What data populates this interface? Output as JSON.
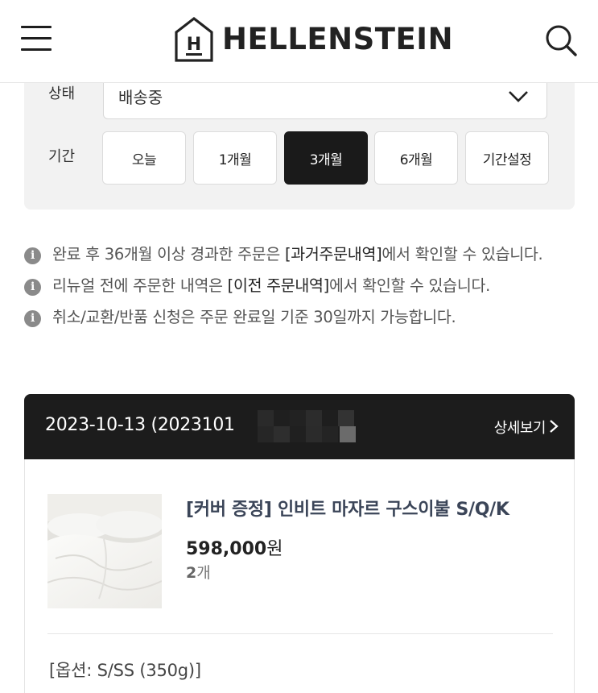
{
  "brand": {
    "name": "HELLENSTEIN",
    "mark_letter": "H"
  },
  "icons": {
    "menu": "hamburger-icon",
    "search": "search-icon",
    "dropdown": "chevron-down-icon",
    "info": "info-icon",
    "detail": "chevron-right-icon"
  },
  "filter": {
    "status_label": "상태",
    "status_value": "배송중",
    "period_label": "기간",
    "periods": [
      "오늘",
      "1개월",
      "3개월",
      "6개월",
      "기간설정"
    ],
    "active_period": "3개월"
  },
  "notices": [
    {
      "before": "완료 후 36개월 이상 경과한 주문은 ",
      "link": "[과거주문내역]",
      "after": "에서 확인할 수 있습니다."
    },
    {
      "before": "리뉴얼 전에 주문한 내역은 ",
      "link": "[이전 주문내역]",
      "after": "에서 확인할 수 있습니다."
    },
    {
      "before": "취소/교환/반품 신청은 주문 완료일 기준 30일까지 가능합니다.",
      "link": "",
      "after": ""
    }
  ],
  "order": {
    "date_and_number": "2023-10-13 (2023101",
    "detail_label": "상세보기",
    "product_name": "[커버 증정] 인비트 마자르 구스이불 S/Q/K",
    "price": "598,000",
    "price_unit": "원",
    "qty": "2",
    "qty_unit": "개",
    "option": "[옵션: S/SS (350g)]"
  },
  "colors": {
    "active_button": "#1a1a1a",
    "order_header": "#1c1c1c",
    "filter_bg": "#f2f2f2",
    "product_name": "#3b4558"
  }
}
